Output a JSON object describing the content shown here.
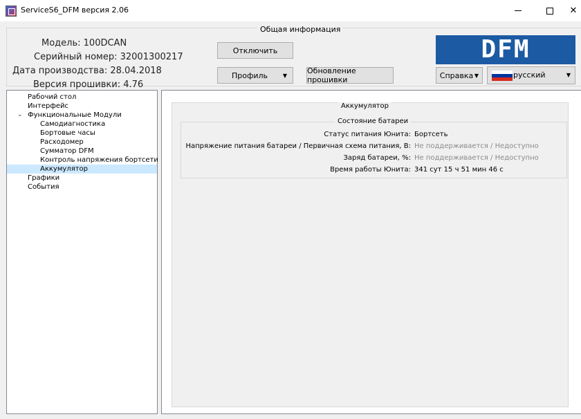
{
  "window": {
    "title": "ServiceS6_DFM версия 2.06"
  },
  "info": {
    "section_title": "Общая информация",
    "model_label": "Модель:",
    "model_value": "100DCAN",
    "serial_label": "Серийный номер:",
    "serial_value": "32001300217",
    "date_label": "Дата производства:",
    "date_value": "28.04.2018",
    "firmware_label": "Версия прошивки:",
    "firmware_value": "4.76"
  },
  "toolbar": {
    "disconnect_label": "Отключить",
    "profile_label": "Профиль",
    "update_label": "Обновление прошивки",
    "help_label": "Справка",
    "language_value": "русский"
  },
  "logo": {
    "text": "DFM"
  },
  "tree": {
    "items": [
      {
        "label": "Рабочий стол",
        "level": 0
      },
      {
        "label": "Интерфейс",
        "level": 0
      },
      {
        "label": "Функциональные Модули",
        "level": 0,
        "expanded": true
      },
      {
        "label": "Самодиагностика",
        "level": 1
      },
      {
        "label": "Бортовые часы",
        "level": 1
      },
      {
        "label": "Расходомер",
        "level": 1
      },
      {
        "label": "Сумматор DFM",
        "level": 1
      },
      {
        "label": "Контроль напряжения бортсети",
        "level": 1
      },
      {
        "label": "Аккумулятор",
        "level": 1,
        "selected": true
      },
      {
        "label": "Графики",
        "level": 0
      },
      {
        "label": "События",
        "level": 0
      }
    ]
  },
  "content": {
    "group_title": "Аккумулятор",
    "battery_group_title": "Состояние батареи",
    "rows": [
      {
        "label": "Статус питания Юнита:",
        "value": "Бортсеть",
        "disabled": false
      },
      {
        "label": "Напряжение питания батареи / Первичная схема питания, В:",
        "value": "Не поддерживается / Недоступно",
        "disabled": true
      },
      {
        "label": "Заряд батареи, %:",
        "value": "Не поддерживается / Недоступно",
        "disabled": true
      },
      {
        "label": "Время работы Юнита:",
        "value": "341 сут 15 ч 51 мин 46 с",
        "disabled": false
      }
    ]
  },
  "colors": {
    "logo_bg": "#1c5aa3",
    "selection": "#cce8ff",
    "disabled_text": "#8a8a8a"
  }
}
